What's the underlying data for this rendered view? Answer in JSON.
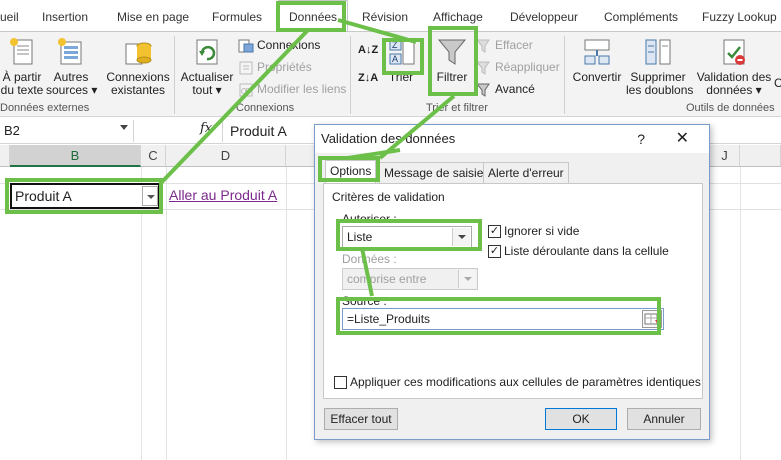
{
  "ribbon_tabs": {
    "accueil": "ueil",
    "insertion": "Insertion",
    "mise_en_page": "Mise en page",
    "formules": "Formules",
    "donnees": "Données",
    "revision": "Révision",
    "affichage": "Affichage",
    "developpeur": "Développeur",
    "complements": "Compléments",
    "fuzzy": "Fuzzy Lookup"
  },
  "ribbon": {
    "a_partir_line1": "À partir",
    "a_partir_line2": "du texte",
    "autres_line1": "Autres",
    "autres_line2": "sources ▾",
    "connexions_exist_line1": "Connexions",
    "connexions_exist_line2": "existantes",
    "group_donnees_ext": "Données externes",
    "actualiser_line1": "Actualiser",
    "actualiser_line2": "tout ▾",
    "connexions": "Connexions",
    "proprietes": "Propriétés",
    "modifier_liens": "Modifier les liens",
    "group_connexions": "Connexions",
    "trier": "Trier",
    "filtrer": "Filtrer",
    "effacer": "Effacer",
    "reappliquer": "Réappliquer",
    "avance": "Avancé",
    "group_trier": "Trier et filtrer",
    "convertir": "Convertir",
    "supprimer_line1": "Supprimer",
    "supprimer_line2": "les doublons",
    "validation_line1": "Validation des",
    "validation_line2": "données ▾",
    "last_btn": "C",
    "group_outils": "Outils de données"
  },
  "formula_bar": {
    "name_box": "B2",
    "fx": "fx",
    "value": "Produit A"
  },
  "columns": [
    "B",
    "C",
    "D",
    "J"
  ],
  "sheet": {
    "b2_value": "Produit A",
    "d2_link": "Aller au Produit A"
  },
  "dialog": {
    "title": "Validation des données",
    "help": "?",
    "close": "✕",
    "tabs": [
      "Options",
      "Message de saisie",
      "Alerte d'erreur"
    ],
    "criteria_label": "Critères de validation",
    "allow_label": "Autoriser :",
    "allow_value": "Liste",
    "ignore_blank": "Ignorer si vide",
    "in_cell_dropdown": "Liste déroulante dans la cellule",
    "data_label": "Données :",
    "data_value": "comprise entre",
    "source_label": "Source :",
    "source_value": "=Liste_Produits",
    "apply_all": "Appliquer ces modifications aux cellules de paramètres identiques",
    "btn_clear": "Effacer tout",
    "btn_ok": "OK",
    "btn_cancel": "Annuler"
  },
  "colors": {
    "highlight": "#6cc04a",
    "excel_green": "#217346",
    "link": "#7b2a8c"
  }
}
